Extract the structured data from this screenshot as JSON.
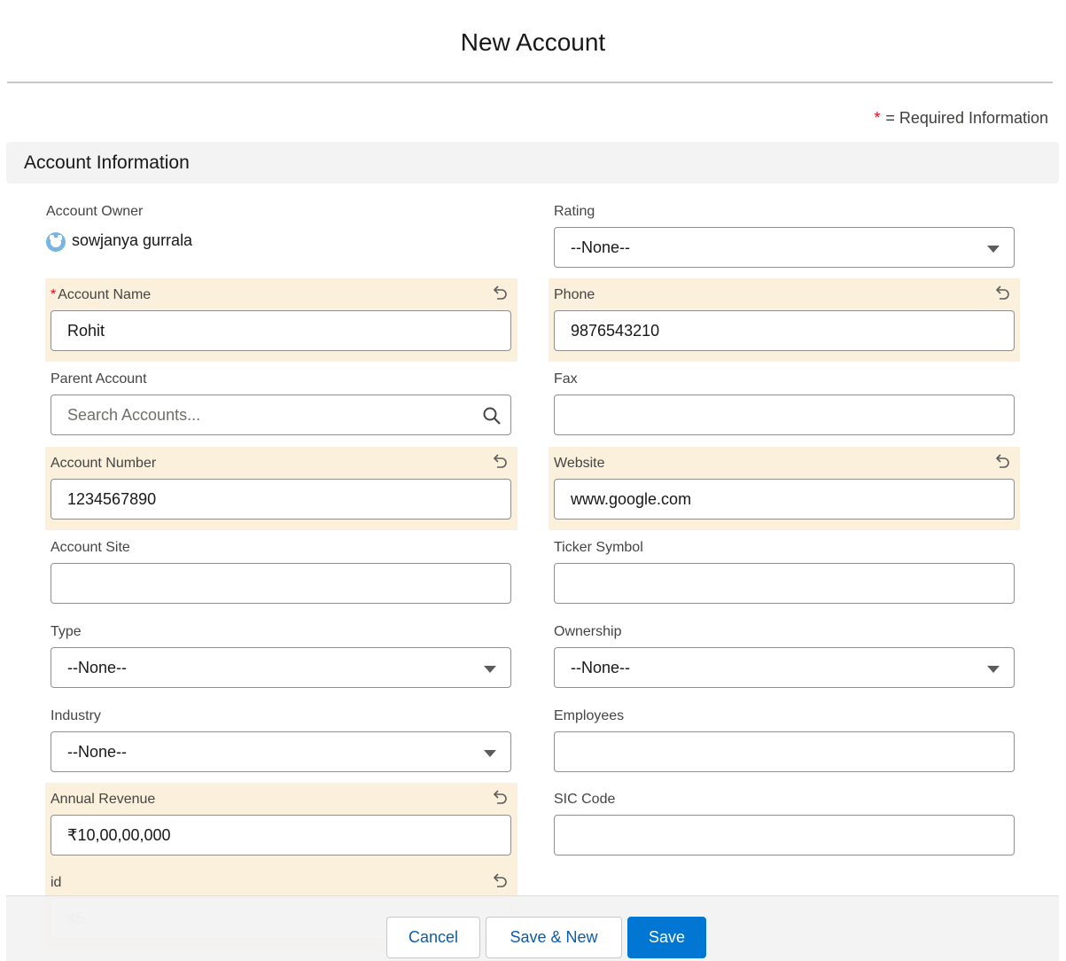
{
  "modal": {
    "title": "New Account"
  },
  "required_note": {
    "star": "*",
    "text": "= Required Information"
  },
  "section": {
    "title": "Account Information"
  },
  "owner": {
    "label": "Account Owner",
    "name": "sowjanya gurrala"
  },
  "fields": {
    "rating": {
      "label": "Rating",
      "value": "--None--"
    },
    "account_name": {
      "required_mark": "*",
      "label": "Account Name",
      "value": "Rohit"
    },
    "phone": {
      "label": "Phone",
      "value": "9876543210"
    },
    "parent_account": {
      "label": "Parent Account",
      "placeholder": "Search Accounts..."
    },
    "fax": {
      "label": "Fax",
      "value": ""
    },
    "account_number": {
      "label": "Account Number",
      "value": "1234567890"
    },
    "website": {
      "label": "Website",
      "value": "www.google.com"
    },
    "account_site": {
      "label": "Account Site",
      "value": ""
    },
    "ticker_symbol": {
      "label": "Ticker Symbol",
      "value": ""
    },
    "type": {
      "label": "Type",
      "value": "--None--"
    },
    "ownership": {
      "label": "Ownership",
      "value": "--None--"
    },
    "industry": {
      "label": "Industry",
      "value": "--None--"
    },
    "employees": {
      "label": "Employees",
      "value": ""
    },
    "annual_revenue": {
      "label": "Annual Revenue",
      "value": "₹10,00,00,000"
    },
    "sic_code": {
      "label": "SIC Code",
      "value": ""
    },
    "id": {
      "label": "id",
      "value": "45"
    }
  },
  "buttons": {
    "cancel": "Cancel",
    "save_new": "Save & New",
    "save": "Save"
  },
  "colors": {
    "edited_bg": "#faf0dc",
    "brand": "#0176d3",
    "required": "#ea001e"
  },
  "icons": {
    "undo": "undo-icon",
    "search": "search-icon",
    "dropdown": "chevron-down-icon"
  }
}
